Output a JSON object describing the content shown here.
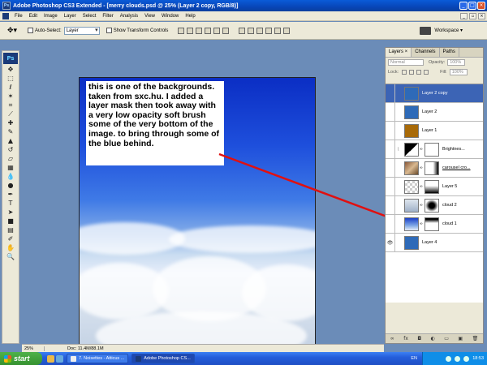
{
  "window": {
    "title": "Adobe Photoshop CS3 Extended - [merry clouds.psd @ 25% (Layer 2 copy, RGB/8)]"
  },
  "menu": [
    "File",
    "Edit",
    "Image",
    "Layer",
    "Select",
    "Filter",
    "Analysis",
    "View",
    "Window",
    "Help"
  ],
  "options": {
    "auto_select_label": "Auto-Select:",
    "auto_select_value": "Layer",
    "show_transform_label": "Show Transform Controls",
    "workspace_label": "Workspace ▾"
  },
  "toolbox": {
    "logo": "Ps"
  },
  "canvas": {
    "note": "this is one of the backgrounds. taken from sxc.hu.  I added a layer mask then took away with a very low opacity soft brush some of the very bottom of the image. to bring through some of the blue behind.",
    "annotation_color": "#e01010"
  },
  "status": {
    "zoom": "25%",
    "doc": "Doc: 11.4M/88.1M"
  },
  "layers_panel": {
    "tabs": [
      "Layers ×",
      "Channels",
      "Paths"
    ],
    "blend_mode": "Normal",
    "opacity_label": "Opacity:",
    "opacity_value": "100%",
    "lock_label": "Lock:",
    "fill_label": "Fill:",
    "fill_value": "100%",
    "layers": [
      {
        "name": "Layer 2 copy",
        "thumb": "#2e6ab8",
        "selected": true
      },
      {
        "name": "Layer 2",
        "thumb": "#2e6ab8"
      },
      {
        "name": "Layer 1",
        "thumb": "#a86a08"
      },
      {
        "name": "Brightnes...",
        "thumb": "adjust",
        "mask": true
      },
      {
        "name": "carousel cro...",
        "thumb": "photo",
        "mask": true
      },
      {
        "name": "Layer 5",
        "thumb": "clouds",
        "mask": true
      },
      {
        "name": "cloud 2",
        "thumb": "clouds2",
        "mask": true
      },
      {
        "name": "cloud 1",
        "thumb": "sky",
        "mask": true
      },
      {
        "name": "Layer 4",
        "thumb": "#2e6ab8",
        "visible_eye": true
      }
    ],
    "footer_icons": [
      "link-icon",
      "fx-icon",
      "mask-icon",
      "adjustment-icon",
      "folder-icon",
      "new-layer-icon",
      "trash-icon"
    ]
  },
  "taskbar": {
    "start_label": "start",
    "tasks": [
      "7. Noisettes - Atticus ...",
      "Adobe Photoshop CS..."
    ],
    "lang": "EN",
    "clock": "18:53"
  }
}
